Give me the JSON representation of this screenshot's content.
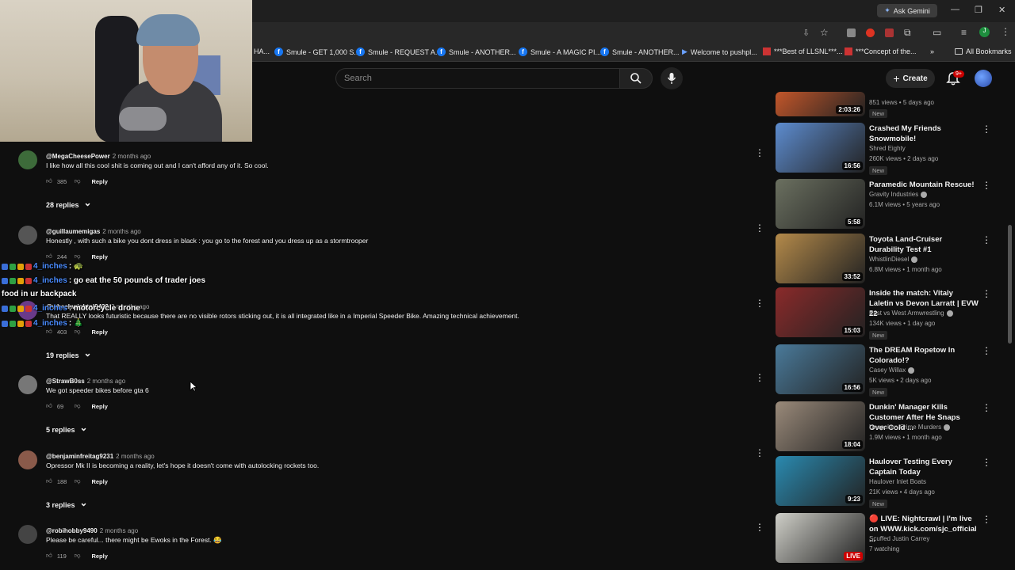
{
  "browser": {
    "ask_gemini": "Ask Gemini",
    "bookmarks": [
      {
        "label": "HA...",
        "icon": "none"
      },
      {
        "label": "Smule - GET 1,000 S...",
        "icon": "facebook"
      },
      {
        "label": "Smule - REQUEST A...",
        "icon": "facebook"
      },
      {
        "label": "Smule - ANOTHER...",
        "icon": "facebook"
      },
      {
        "label": "Smule - A MAGIC PI...",
        "icon": "facebook"
      },
      {
        "label": "Smule - ANOTHER...",
        "icon": "facebook"
      },
      {
        "label": "Welcome to pushpl...",
        "icon": "pushpl"
      },
      {
        "label": "***Best of LLSNL***...",
        "icon": "snl"
      },
      {
        "label": "***Concept of the...",
        "icon": "snl"
      },
      {
        "label": "All Bookmarks",
        "icon": "folder"
      }
    ],
    "more": "»"
  },
  "header": {
    "search_placeholder": "Search",
    "create_label": "Create",
    "notifications_badge": "9+"
  },
  "chat_overlay": [
    {
      "user": "4_inches",
      "text": ": 🐢"
    },
    {
      "user": "4_inches",
      "text": ": go eat the 50 pounds of trader joes"
    },
    {
      "user": "",
      "text": "food in ur backpack"
    },
    {
      "user": "4_inches",
      "text": ": motorcycle drone"
    },
    {
      "user": "4_inches",
      "text": ": 🎄"
    }
  ],
  "comments": [
    {
      "author": "@MegaCheesePower",
      "time": "2 months ago",
      "text": "I like how all this cool shit is coming out and I can't afford any of it. So cool.",
      "likes": "385",
      "reply": "Reply",
      "replies": "28 replies",
      "avatar_color": "#3d6b3a"
    },
    {
      "author": "@guillaumemigas",
      "time": "2 months ago",
      "text": "Honestly , with such a bike you dont dress in black : you go to the forest and you dress up as a stormtrooper",
      "likes": "244",
      "reply": "Reply",
      "replies": "",
      "avatar_color": "#555"
    },
    {
      "author": "@wheelwrightpl9429",
      "time": "2 months ago",
      "text": "That REALLY looks futuristic because there are no visible rotors sticking out, it is all integrated like in a Imperial Speeder Bike. Amazing technical achievement.",
      "likes": "403",
      "reply": "Reply",
      "replies": "19 replies",
      "avatar_color": "#6a3a8a"
    },
    {
      "author": "@StrawB0ss",
      "time": "2 months ago",
      "text": "We got speeder bikes before gta 6",
      "likes": "69",
      "reply": "Reply",
      "replies": "5 replies",
      "avatar_color": "#777"
    },
    {
      "author": "@benjaminfreitag9231",
      "time": "2 months ago",
      "text": "Opressor Mk II is becoming a reality, let's hope it doesn't come with autolocking rockets too.",
      "likes": "188",
      "reply": "Reply",
      "replies": "3 replies",
      "avatar_color": "#8a5a4a"
    },
    {
      "author": "@robihobby9490",
      "time": "2 months ago",
      "text": "Please be careful... there might be Ewoks in the Forest. 😂",
      "likes": "119",
      "reply": "Reply",
      "replies": "",
      "avatar_color": "#444"
    }
  ],
  "sidebar": [
    {
      "title": "",
      "channel": "",
      "meta": "851 views • 5 days ago",
      "new": "New",
      "duration": "2:03:26",
      "thumb": "#c2562a"
    },
    {
      "title": "Crashed My Friends Snowmobile!",
      "channel": "Shred Eighty",
      "verified": false,
      "meta": "260K views • 2 days ago",
      "new": "New",
      "duration": "16:56",
      "thumb": "#5d8ccf"
    },
    {
      "title": "Paramedic Mountain Rescue!",
      "channel": "Gravity Industries",
      "verified": true,
      "meta": "6.1M views • 5 years ago",
      "new": "",
      "duration": "5:58",
      "thumb": "#6b7060"
    },
    {
      "title": "Toyota Land-Cruiser Durability Test #1",
      "channel": "WhistlinDiesel",
      "verified": true,
      "meta": "6.8M views • 1 month ago",
      "new": "",
      "duration": "33:52",
      "thumb": "#b48a4a"
    },
    {
      "title": "Inside the match: Vitaly Laletin vs Devon Larratt | EVW 22",
      "channel": "East vs West Armwrestling",
      "verified": true,
      "meta": "134K views • 1 day ago",
      "new": "New",
      "duration": "15:03",
      "thumb": "#8a2a2a"
    },
    {
      "title": "The DREAM Ropetow In Colorado!?",
      "channel": "Casey Willax",
      "verified": true,
      "meta": "5K views • 2 days ago",
      "new": "New",
      "duration": "16:56",
      "thumb": "#4a7a9a"
    },
    {
      "title": "Dunkin' Manager Kills Customer After He Snaps Over Cold ...",
      "channel": "Unspoken Crime Murders",
      "verified": true,
      "meta": "1.9M views • 1 month ago",
      "new": "",
      "duration": "18:04",
      "thumb": "#9a8a7a"
    },
    {
      "title": "Haulover Testing Every Captain Today",
      "channel": "Haulover Inlet Boats",
      "verified": false,
      "meta": "21K views • 4 days ago",
      "new": "New",
      "duration": "9:23",
      "thumb": "#2a8ab0"
    },
    {
      "title": "🔴 LIVE: Nightcrawl | I'm live on WWW.kick.com/sjc_official ...",
      "channel": "Scuffed Justin Carrey",
      "verified": false,
      "meta": "7 watching",
      "new": "",
      "duration": "LIVE",
      "thumb": "#cfcfc8"
    }
  ]
}
